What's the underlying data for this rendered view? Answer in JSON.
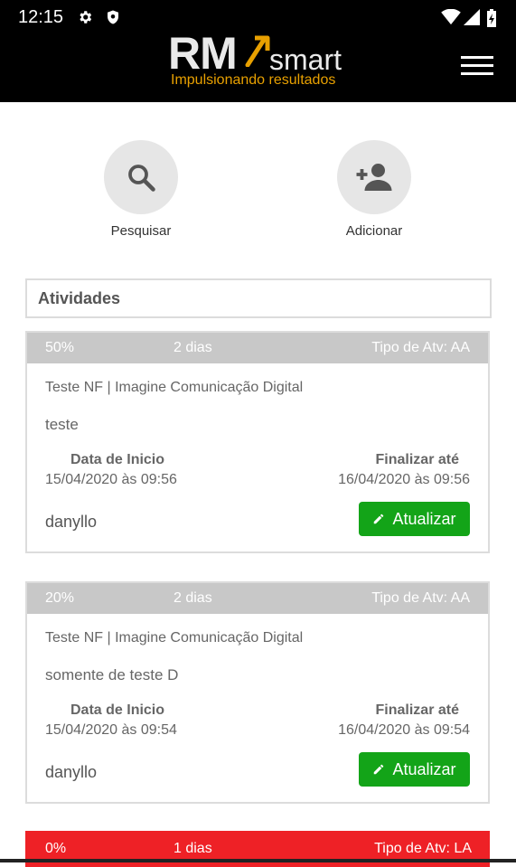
{
  "status_bar": {
    "time": "12:15"
  },
  "header": {
    "logo_main": "RM",
    "logo_suffix": "smart",
    "tagline": "Impulsionando resultados"
  },
  "actions": [
    {
      "label": "Pesquisar",
      "icon": "search-icon"
    },
    {
      "label": "Adicionar",
      "icon": "add-person-icon"
    }
  ],
  "section": {
    "title": "Atividades"
  },
  "cards": [
    {
      "percent": "50%",
      "days": "2 dias",
      "type": "Tipo de Atv: AA",
      "client": "Teste NF | Imagine Comunicação Digital",
      "description": "teste",
      "start_label": "Data de Inicio",
      "start_value": "15/04/2020 às 09:56",
      "end_label": "Finalizar até",
      "end_value": "16/04/2020 às 09:56",
      "user": "danyllo",
      "button": "Atualizar"
    },
    {
      "percent": "20%",
      "days": "2 dias",
      "type": "Tipo de Atv: AA",
      "client": "Teste NF | Imagine Comunicação Digital",
      "description": "somente de teste D",
      "start_label": "Data de Inicio",
      "start_value": "15/04/2020 às 09:54",
      "end_label": "Finalizar até",
      "end_value": "16/04/2020 às 09:54",
      "user": "danyllo",
      "button": "Atualizar"
    },
    {
      "percent": "0%",
      "days": "1 dias",
      "type": "Tipo de Atv: LA"
    }
  ],
  "colors": {
    "header_bg": "#000000",
    "tagline": "#e8a000",
    "update_button": "#13a418",
    "card_bar": "#c8c8c8",
    "overdue_bar": "#ee2126"
  }
}
